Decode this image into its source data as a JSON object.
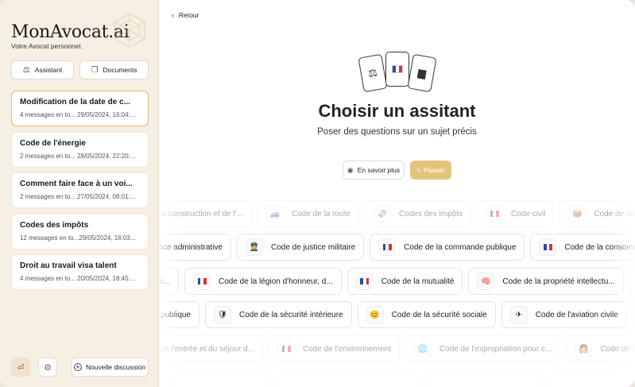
{
  "sidebar": {
    "brand": "MonAvocat.ai",
    "tagline": "Votre Avocat personnel.",
    "assistant_label": "Assistant",
    "documents_label": "Documents",
    "conversations": [
      {
        "title": "Modification de la date de c...",
        "meta": "4 messages en to... 29/05/2024, 16:04:..."
      },
      {
        "title": "Code de l'énergie",
        "meta": "2 messages en to... 28/05/2024, 22:20:..."
      },
      {
        "title": "Comment faire face à un voi...",
        "meta": "2 messages en to... 27/05/2024, 08:01:..."
      },
      {
        "title": "Codes des impôts",
        "meta": "12 messages en to...29/05/2024, 16:03..."
      },
      {
        "title": "Droit au travail visa talent",
        "meta": "4 messages en to... 20/05/2024, 18:45:..."
      }
    ],
    "new_discussion_label": "Nouvelle discussion"
  },
  "main": {
    "back_label": "Retour",
    "title": "Choisir un assitant",
    "subtitle": "Poser des questions sur un sujet précis",
    "learn_more_label": "En savoir plus",
    "skip_label": "Passer"
  },
  "chips": {
    "row0": [
      "de la construction et de l'...",
      "Code de la route",
      "Codes des impôts",
      "Code civil",
      "Code de comm"
    ],
    "row1": [
      "tice administrative",
      "Code de justice militaire",
      "Code de la commande publique",
      "Code de la consommation"
    ],
    "row2": [
      "s...",
      "Code de la légion d'honneur, d...",
      "Code de la mutualité",
      "Code de la propriété intellectu..."
    ],
    "row3": [
      "publique",
      "Code de la sécurité intérieure",
      "Code de la sécurité sociale",
      "Code de l'aviation civile"
    ],
    "row4": [
      "de de l'entrée et du séjour d...",
      "Code de l'environnement",
      "Code de l'expropriation pour c...",
      "Code de l'org"
    ]
  },
  "colors": {
    "accent": "#e4c47d",
    "sidebar_bg": "#f6efe3",
    "active_border": "#e3b968",
    "flag_blue": "#2b4fa3",
    "flag_red": "#d8323c"
  }
}
